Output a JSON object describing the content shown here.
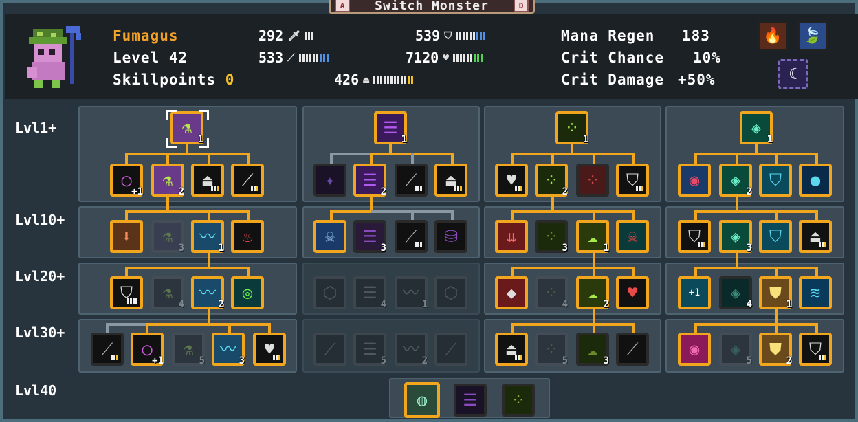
{
  "title": "Switch Monster",
  "title_keys": {
    "left": "A",
    "right": "D"
  },
  "monster": {
    "name": "Fumagus",
    "level_label": "Level 42",
    "skillpoints_label": "Skillpoints",
    "skillpoints_value": "0"
  },
  "stats": {
    "attack": "292",
    "magic": "533",
    "defense": "539",
    "health": "7120",
    "mana": "426"
  },
  "secondary": {
    "mana_regen_label": "Mana Regen",
    "mana_regen_value": "183",
    "crit_chance_label": "Crit Chance",
    "crit_chance_value": "10%",
    "crit_damage_label": "Crit Damage",
    "crit_damage_value": "+50%"
  },
  "level_tiers": [
    "Lvl1+",
    "Lvl10+",
    "Lvl20+",
    "Lvl30+",
    "Lvl40"
  ],
  "ranks": {
    "t1_root": "1",
    "t1_l1b": "2",
    "t1_l10c": "3",
    "t1_l10d": "1",
    "t1_l20b": "4",
    "t1_l20c": "2",
    "t1_l30c": "5",
    "t1_l30d": "3",
    "t2_root": "1",
    "t2_l1b": "2",
    "t2_l10b": "3",
    "t2_l20b": "4",
    "t2_l20c": "1",
    "t2_l30b": "5",
    "t2_l30c": "2",
    "t3_root": "1",
    "t3_l1b": "2",
    "t3_l10b": "3",
    "t3_l10c": "1",
    "t3_l20b": "4",
    "t3_l20c": "2",
    "t3_l30b": "5",
    "t3_l30c": "3",
    "t4_root": "1",
    "t4_l1b": "2",
    "t4_l10b": "3",
    "t4_l20b": "4",
    "t4_l20c": "1",
    "t4_l30b": "5",
    "t4_l30c": "2",
    "plus_one": "+1"
  },
  "colors": {
    "accent_orange": "#f2a61e",
    "name_orange": "#f3a227",
    "panel": "#3b4a55",
    "header_bg": "#1c2126"
  }
}
